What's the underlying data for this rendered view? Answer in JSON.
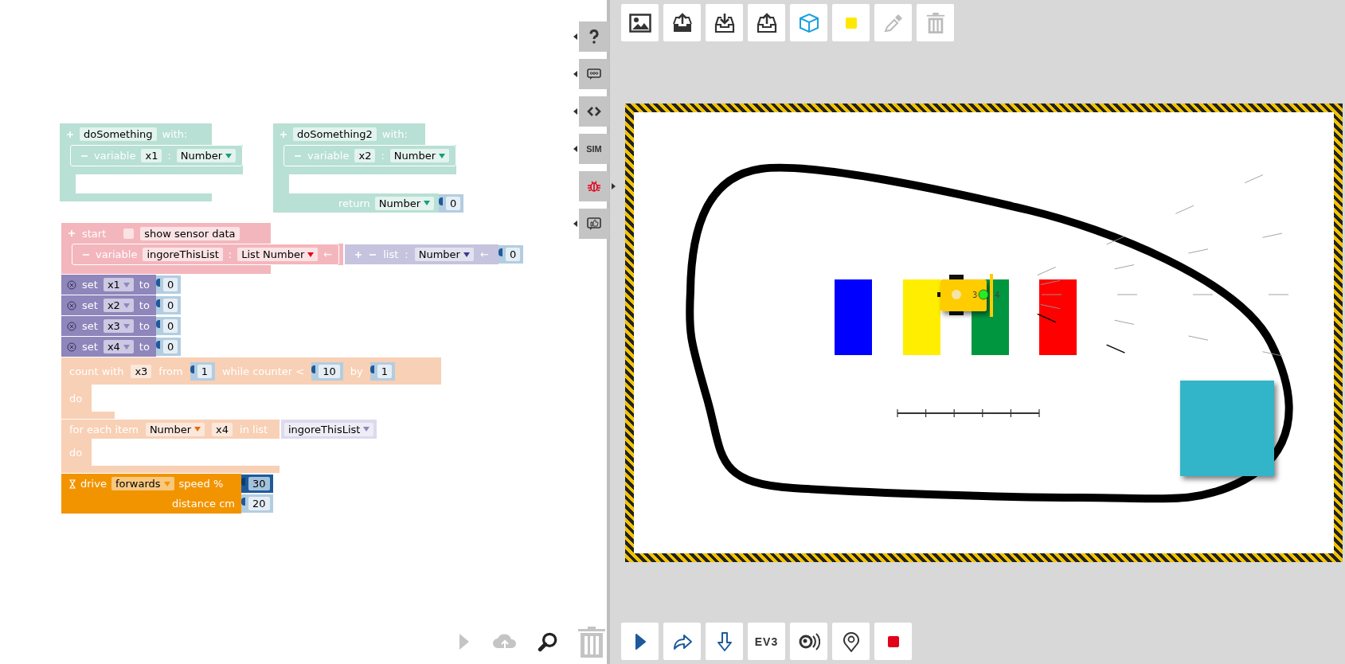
{
  "side_tabs": [
    {
      "kind": "help",
      "open": false
    },
    {
      "kind": "chat",
      "open": false
    },
    {
      "kind": "code",
      "open": false
    },
    {
      "kind": "text",
      "label": "SIM",
      "open": false
    },
    {
      "kind": "bug",
      "open": true
    },
    {
      "kind": "feedback",
      "open": false
    }
  ],
  "procedures": [
    {
      "name": "doSomething",
      "with": "with:",
      "param_label": "variable",
      "param_name": "x1",
      "colon": ":",
      "param_type": "Number"
    },
    {
      "name": "doSomething2",
      "with": "with:",
      "param_label": "variable",
      "param_name": "x2",
      "colon": ":",
      "param_type": "Number",
      "return_label": "return",
      "return_type": "Number",
      "return_value": "0"
    }
  ],
  "start": {
    "label": "start",
    "checkbox_checked": false,
    "checkbox_label": "show sensor data",
    "var_label": "variable",
    "var_name": "ingoreThisList",
    "colon": ":",
    "var_type": "List Number",
    "arrow": "←",
    "list": {
      "label": "list",
      "colon": ":",
      "type": "Number",
      "arrow": "←",
      "value": "0"
    }
  },
  "statements": [
    {
      "kind": "set",
      "label": "set",
      "var": "x1",
      "to": "to",
      "value": "0"
    },
    {
      "kind": "set",
      "label": "set",
      "var": "x2",
      "to": "to",
      "value": "0"
    },
    {
      "kind": "set",
      "label": "set",
      "var": "x3",
      "to": "to",
      "value": "0"
    },
    {
      "kind": "set",
      "label": "set",
      "var": "x4",
      "to": "to",
      "value": "0"
    },
    {
      "kind": "count",
      "label": "count with",
      "var": "x3",
      "from": "from",
      "from_value": "1",
      "while": "while counter <",
      "to_value": "10",
      "by": "by",
      "by_value": "1",
      "do": "do"
    },
    {
      "kind": "foreach",
      "label": "for each item",
      "type": "Number",
      "var": "x4",
      "in_list": "in list",
      "list": "ingoreThisList",
      "do": "do"
    },
    {
      "kind": "drive",
      "label": "drive",
      "direction": "forwards",
      "speed_label": "speed %",
      "speed": "30",
      "distance_label": "distance cm",
      "distance": "20"
    }
  ],
  "workspace_tools": [
    {
      "kind": "run",
      "disabled": true
    },
    {
      "kind": "cloud",
      "disabled": true
    },
    {
      "kind": "zoom",
      "disabled": false
    },
    {
      "kind": "trash",
      "disabled": true
    }
  ],
  "sim_toolbar": [
    {
      "kind": "image",
      "disabled": false
    },
    {
      "kind": "upload",
      "disabled": false
    },
    {
      "kind": "download",
      "disabled": false
    },
    {
      "kind": "import",
      "disabled": false
    },
    {
      "kind": "cube",
      "disabled": false
    },
    {
      "kind": "color",
      "disabled": false
    },
    {
      "kind": "eyedropper",
      "disabled": true
    },
    {
      "kind": "trash",
      "disabled": true
    }
  ],
  "scene": {
    "obstacles": [
      {
        "color": "#0000ff"
      },
      {
        "color": "#ffee00"
      },
      {
        "color": "#009640"
      },
      {
        "color": "#ff0000"
      },
      {
        "color": "#33b5c9"
      }
    ],
    "robot": {
      "port_labels": [
        "3",
        "4"
      ]
    }
  },
  "sim_controls": [
    {
      "kind": "play"
    },
    {
      "kind": "share"
    },
    {
      "kind": "download"
    },
    {
      "kind": "text",
      "label": "EV3"
    },
    {
      "kind": "sound"
    },
    {
      "kind": "pin"
    },
    {
      "kind": "stop"
    }
  ]
}
